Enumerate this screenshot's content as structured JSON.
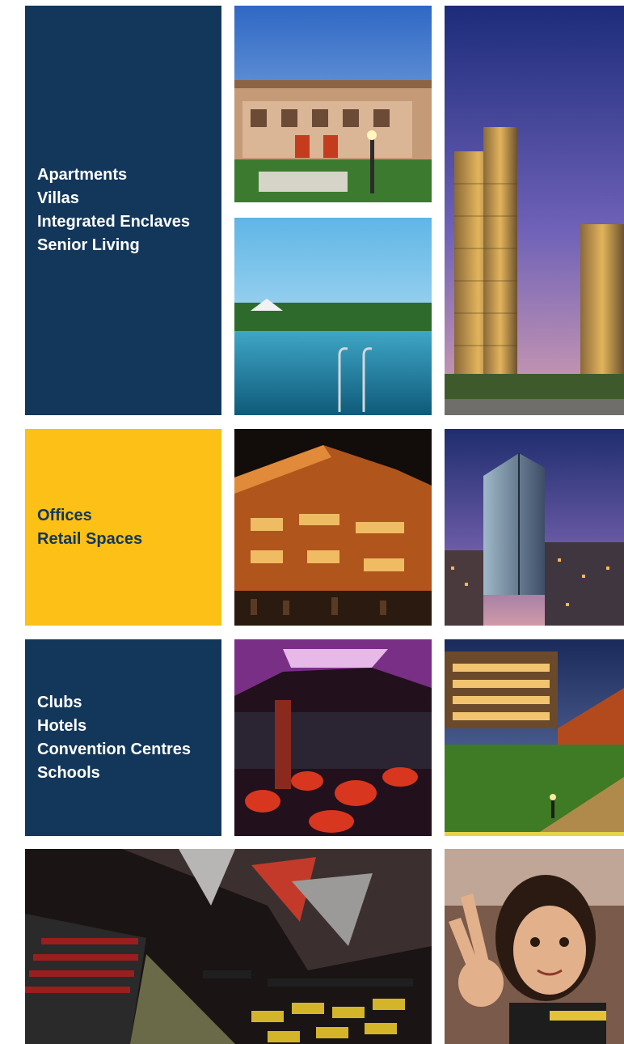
{
  "residential": {
    "color": "#13375b",
    "lines": [
      "Apartments",
      "Villas",
      "Integrated Enclaves",
      "Senior Living"
    ]
  },
  "commercial": {
    "color": "#fcc016",
    "lines": [
      "Offices",
      "Retail Spaces"
    ]
  },
  "hospitality": {
    "color": "#13375b",
    "lines": [
      "Clubs",
      "Hotels",
      "Convention Centres",
      "Schools"
    ]
  },
  "photos": [
    {
      "icon": "villa-photo"
    },
    {
      "icon": "pool-photo"
    },
    {
      "icon": "towers-photo"
    },
    {
      "icon": "mall-photo"
    },
    {
      "icon": "office-tower-photo"
    },
    {
      "icon": "lounge-photo"
    },
    {
      "icon": "hotel-photo"
    },
    {
      "icon": "auditorium-photo"
    },
    {
      "icon": "child-photo"
    }
  ]
}
